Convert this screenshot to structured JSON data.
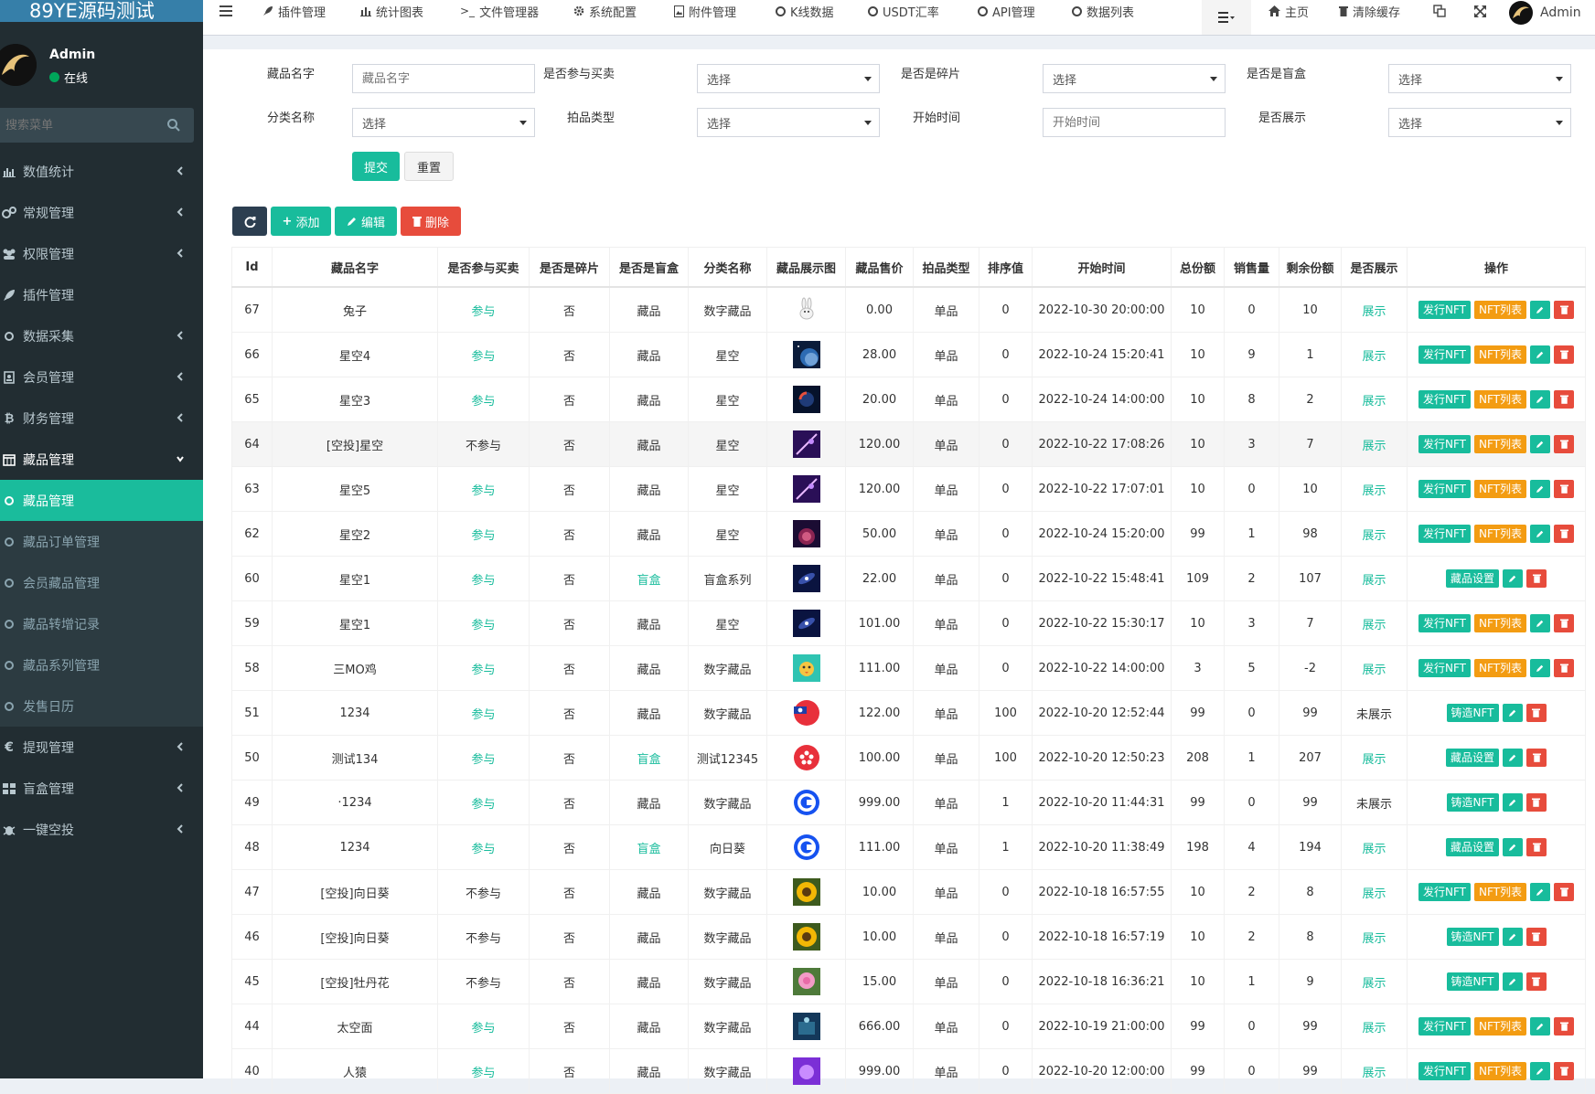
{
  "app": {
    "title": "89YE源码测试",
    "user_name": "Admin",
    "user_status": "在线"
  },
  "sidebar": {
    "search_placeholder": "搜索菜单",
    "items": [
      {
        "label": "数值统计",
        "icon": "bar-chart-icon"
      },
      {
        "label": "常规管理",
        "icon": "cogs-icon"
      },
      {
        "label": "权限管理",
        "icon": "group-icon"
      },
      {
        "label": "插件管理",
        "icon": "rocket-icon"
      },
      {
        "label": "数据采集",
        "icon": "circle-icon"
      },
      {
        "label": "会员管理",
        "icon": "address-book-icon"
      },
      {
        "label": "财务管理",
        "icon": "bitcoin-icon"
      },
      {
        "label": "藏品管理",
        "icon": "calendar-icon"
      }
    ],
    "sub_items": [
      {
        "label": "藏品管理"
      },
      {
        "label": "藏品订单管理"
      },
      {
        "label": "会员藏品管理"
      },
      {
        "label": "藏品转增记录"
      },
      {
        "label": "藏品系列管理"
      },
      {
        "label": "发售日历"
      }
    ],
    "items_after": [
      {
        "label": "提现管理",
        "icon": "euro-icon"
      },
      {
        "label": "盲盒管理",
        "icon": "th-icon"
      },
      {
        "label": "一键空投",
        "icon": "bug-icon"
      }
    ]
  },
  "topnav": {
    "tabs": [
      {
        "label": "插件管理"
      },
      {
        "label": "统计图表"
      },
      {
        "label": "文件管理器"
      },
      {
        "label": "系统配置"
      },
      {
        "label": "附件管理"
      },
      {
        "label": "K线数据"
      },
      {
        "label": "USDT汇率"
      },
      {
        "label": "API管理"
      },
      {
        "label": "数据列表"
      }
    ],
    "home": "主页",
    "clear_cache": "清除缓存",
    "admin": "Admin"
  },
  "filters": {
    "name_label": "藏品名字",
    "name_placeholder": "藏品名字",
    "trade_label": "是否参与买卖",
    "shard_label": "是否是碎片",
    "blindbox_label": "是否是盲盒",
    "category_label": "分类名称",
    "auction_label": "拍品类型",
    "start_label": "开始时间",
    "start_placeholder": "开始时间",
    "show_label": "是否展示",
    "select_text": "选择",
    "submit": "提交",
    "reset": "重置"
  },
  "toolbar": {
    "add": "添加",
    "edit": "编辑",
    "delete": "删除"
  },
  "table": {
    "headers": [
      "Id",
      "藏品名字",
      "是否参与买卖",
      "是否是碎片",
      "是否是盲盒",
      "分类名称",
      "藏品展示图",
      "藏品售价",
      "拍品类型",
      "排序值",
      "开始时间",
      "总份额",
      "销售量",
      "剩余份额",
      "是否展示",
      "操作"
    ],
    "rows": [
      {
        "id": "67",
        "name": "兔子",
        "trade": "参与",
        "shard": "否",
        "box": "藏品",
        "cat": "数字藏品",
        "price": "0.00",
        "type": "单品",
        "sort": "0",
        "time": "2022-10-30 20:00:00",
        "total": "10",
        "sold": "0",
        "left": "10",
        "show": "展示",
        "ops": "nft",
        "thumb": "rabbit"
      },
      {
        "id": "66",
        "name": "星空4",
        "trade": "参与",
        "shard": "否",
        "box": "藏品",
        "cat": "星空",
        "price": "28.00",
        "type": "单品",
        "sort": "0",
        "time": "2022-10-24 15:20:41",
        "total": "10",
        "sold": "9",
        "left": "1",
        "show": "展示",
        "ops": "nft",
        "thumb": "planet"
      },
      {
        "id": "65",
        "name": "星空3",
        "trade": "参与",
        "shard": "否",
        "box": "藏品",
        "cat": "星空",
        "price": "20.00",
        "type": "单品",
        "sort": "0",
        "time": "2022-10-24 14:00:00",
        "total": "10",
        "sold": "8",
        "left": "2",
        "show": "展示",
        "ops": "nft",
        "thumb": "redplanet"
      },
      {
        "id": "64",
        "name": "[空投]星空",
        "trade": "不参与",
        "shard": "否",
        "box": "藏品",
        "cat": "星空",
        "price": "120.00",
        "type": "单品",
        "sort": "0",
        "time": "2022-10-22 17:08:26",
        "total": "10",
        "sold": "3",
        "left": "7",
        "show": "展示",
        "ops": "nft",
        "thumb": "purple"
      },
      {
        "id": "63",
        "name": "星空5",
        "trade": "参与",
        "shard": "否",
        "box": "藏品",
        "cat": "星空",
        "price": "120.00",
        "type": "单品",
        "sort": "0",
        "time": "2022-10-22 17:07:01",
        "total": "10",
        "sold": "0",
        "left": "10",
        "show": "展示",
        "ops": "nft",
        "thumb": "purple"
      },
      {
        "id": "62",
        "name": "星空2",
        "trade": "参与",
        "shard": "否",
        "box": "藏品",
        "cat": "星空",
        "price": "50.00",
        "type": "单品",
        "sort": "0",
        "time": "2022-10-24 15:20:00",
        "total": "99",
        "sold": "1",
        "left": "98",
        "show": "展示",
        "ops": "nft",
        "thumb": "nebula"
      },
      {
        "id": "60",
        "name": "星空1",
        "trade": "参与",
        "shard": "否",
        "box": "盲盒",
        "cat": "盲盒系列",
        "price": "22.00",
        "type": "单品",
        "sort": "0",
        "time": "2022-10-22 15:48:41",
        "total": "109",
        "sold": "2",
        "left": "107",
        "show": "展示",
        "ops": "box",
        "thumb": "galaxy"
      },
      {
        "id": "59",
        "name": "星空1",
        "trade": "参与",
        "shard": "否",
        "box": "藏品",
        "cat": "星空",
        "price": "101.00",
        "type": "单品",
        "sort": "0",
        "time": "2022-10-22 15:30:17",
        "total": "10",
        "sold": "3",
        "left": "7",
        "show": "展示",
        "ops": "nft",
        "thumb": "galaxy"
      },
      {
        "id": "58",
        "name": "三MO鸡",
        "trade": "参与",
        "shard": "否",
        "box": "藏品",
        "cat": "数字藏品",
        "price": "111.00",
        "type": "单品",
        "sort": "0",
        "time": "2022-10-22 14:00:00",
        "total": "3",
        "sold": "5",
        "left": "-2",
        "show": "展示",
        "ops": "nft",
        "thumb": "chick"
      },
      {
        "id": "51",
        "name": "1234",
        "trade": "参与",
        "shard": "否",
        "box": "藏品",
        "cat": "数字藏品",
        "price": "122.00",
        "type": "单品",
        "sort": "100",
        "time": "2022-10-20 12:52:44",
        "total": "99",
        "sold": "0",
        "left": "99",
        "show": "未展示",
        "ops": "mint",
        "thumb": "flag"
      },
      {
        "id": "50",
        "name": "测试134",
        "trade": "参与",
        "shard": "否",
        "box": "盲盒",
        "cat": "测试12345",
        "price": "100.00",
        "type": "单品",
        "sort": "100",
        "time": "2022-10-20 12:50:23",
        "total": "208",
        "sold": "1",
        "left": "207",
        "show": "展示",
        "ops": "box",
        "thumb": "hk"
      },
      {
        "id": "49",
        "name": "·1234",
        "trade": "参与",
        "shard": "否",
        "box": "藏品",
        "cat": "数字藏品",
        "price": "999.00",
        "type": "单品",
        "sort": "1",
        "time": "2022-10-20 11:44:31",
        "total": "99",
        "sold": "0",
        "left": "99",
        "show": "未展示",
        "ops": "mint",
        "thumb": "coin"
      },
      {
        "id": "48",
        "name": "1234",
        "trade": "参与",
        "shard": "否",
        "box": "盲盒",
        "cat": "向日葵",
        "price": "111.00",
        "type": "单品",
        "sort": "1",
        "time": "2022-10-20 11:38:49",
        "total": "198",
        "sold": "4",
        "left": "194",
        "show": "展示",
        "ops": "box",
        "thumb": "coin"
      },
      {
        "id": "47",
        "name": "[空投]向日葵",
        "trade": "不参与",
        "shard": "否",
        "box": "藏品",
        "cat": "数字藏品",
        "price": "10.00",
        "type": "单品",
        "sort": "0",
        "time": "2022-10-18 16:57:55",
        "total": "10",
        "sold": "2",
        "left": "8",
        "show": "展示",
        "ops": "nft",
        "thumb": "sunflower"
      },
      {
        "id": "46",
        "name": "[空投]向日葵",
        "trade": "不参与",
        "shard": "否",
        "box": "藏品",
        "cat": "数字藏品",
        "price": "10.00",
        "type": "单品",
        "sort": "0",
        "time": "2022-10-18 16:57:19",
        "total": "10",
        "sold": "2",
        "left": "8",
        "show": "展示",
        "ops": "mint",
        "thumb": "sunflower"
      },
      {
        "id": "45",
        "name": "[空投]牡丹花",
        "trade": "不参与",
        "shard": "否",
        "box": "藏品",
        "cat": "数字藏品",
        "price": "15.00",
        "type": "单品",
        "sort": "0",
        "time": "2022-10-18 16:36:21",
        "total": "10",
        "sold": "1",
        "left": "9",
        "show": "展示",
        "ops": "mint",
        "thumb": "peony"
      },
      {
        "id": "44",
        "name": "太空面",
        "trade": "参与",
        "shard": "否",
        "box": "藏品",
        "cat": "数字藏品",
        "price": "666.00",
        "type": "单品",
        "sort": "0",
        "time": "2022-10-19 21:00:00",
        "total": "99",
        "sold": "0",
        "left": "99",
        "show": "展示",
        "ops": "nft",
        "thumb": "space"
      },
      {
        "id": "40",
        "name": "人猿",
        "trade": "参与",
        "shard": "否",
        "box": "藏品",
        "cat": "数字藏品",
        "price": "999.00",
        "type": "单品",
        "sort": "0",
        "time": "2022-10-20 12:00:00",
        "total": "99",
        "sold": "0",
        "left": "99",
        "show": "展示",
        "ops": "nft",
        "thumb": "ape"
      }
    ],
    "op_labels": {
      "nft": [
        "发行NFT",
        "NFT列表"
      ],
      "box": [
        "藏品设置"
      ],
      "mint": [
        "铸造NFT"
      ]
    }
  },
  "colors": {
    "sidebar_bg": "#222d32",
    "accent": "#18bc9c",
    "danger": "#e74c3c",
    "warning": "#f39c12",
    "logo_bg": "#367fa9"
  }
}
